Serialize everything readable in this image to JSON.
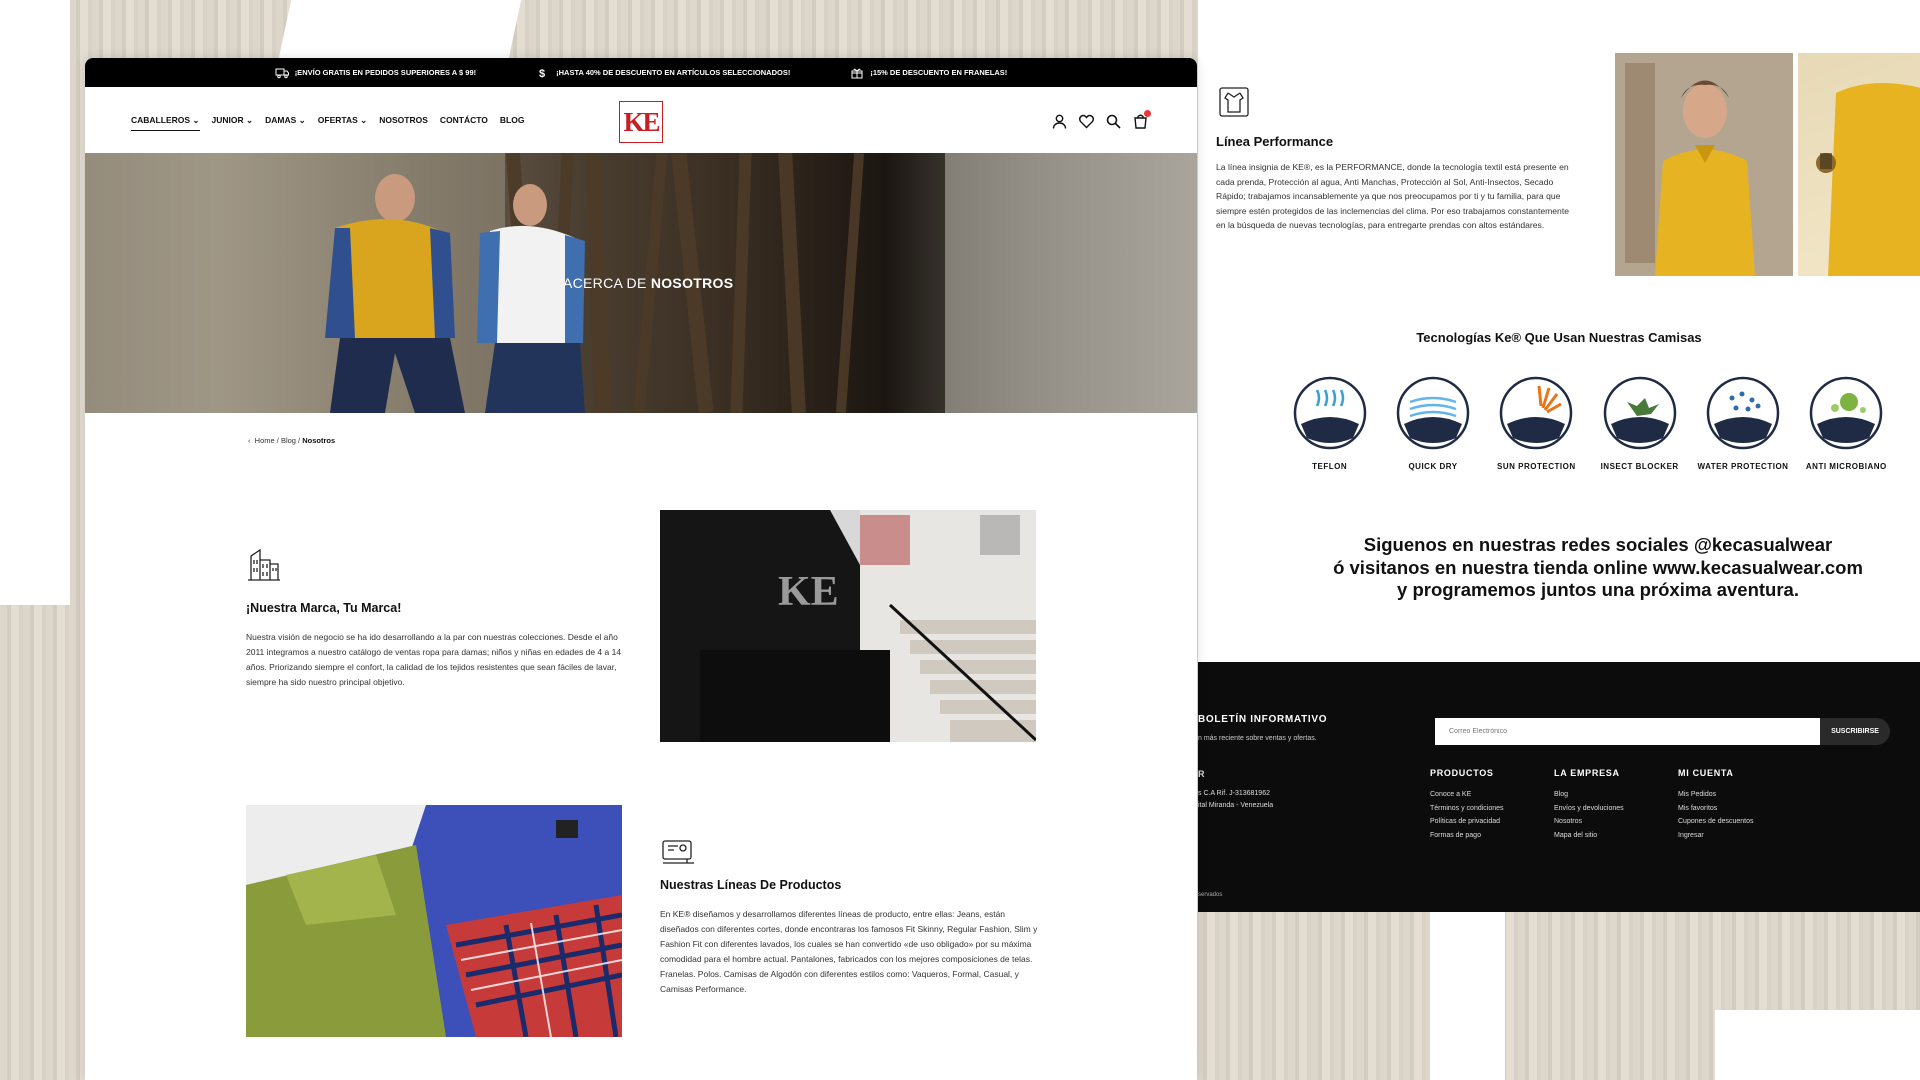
{
  "topbar": {
    "item1": "¡ENVÍO GRATIS EN PEDIDOS SUPERIORES A $ 99!",
    "item2": "¡HASTA 40% DE DESCUENTO EN ARTÍCULOS SELECCIONADOS!",
    "item3": "¡15% DE DESCUENTO EN FRANELAS!"
  },
  "nav": {
    "menu": [
      "CABALLEROS",
      "JUNIOR",
      "DAMAS",
      "OFERTAS",
      "NOSOTROS",
      "CONTÁCTO",
      "BLOG"
    ],
    "logo": "KE"
  },
  "hero": {
    "title_light": "ACERCA DE",
    "title_bold": "NOSOTROS"
  },
  "breadcrumb": {
    "home": "Home",
    "blog": "Blog",
    "current": "Nosotros"
  },
  "brand": {
    "title": "¡Nuestra Marca, Tu Marca!",
    "text": "Nuestra visión de negocio se ha ido desarrollando a la par con nuestras colecciones. Desde el año 2011 integramos a nuestro catálogo de ventas ropa para damas; niños y niñas en edades de 4 a 14 años. Priorizando siempre el confort, la calidad de los tejidos resistentes que sean fáciles de lavar, siempre ha sido nuestro principal objetivo."
  },
  "lines": {
    "title": "Nuestras Líneas De Productos",
    "text": "En KE® diseñamos y desarrollamos diferentes líneas de producto, entre ellas: Jeans, están diseñados con diferentes cortes, donde encontraras los famosos Fit Skinny, Regular Fashion, Slim y Fashion Fit con diferentes lavados, los cuales se han convertido «de uso obligado» por su máxima comodidad para el hombre actual. Pantalones, fabricados con los mejores composiciones de telas. Franelas. Polos. Camisas de Algodón con diferentes estilos como: Vaqueros, Formal, Casual, y Camisas Performance."
  },
  "performance": {
    "title": "Línea Performance",
    "text": "La línea insignia de KE®, es la PERFORMANCE, donde la tecnología textil está presente en cada prenda, Protección al agua, Anti Manchas, Protección al Sol, Anti-Insectos, Secado Rápido; trabajamos incansablemente ya que nos preocupamos por ti y tu familia, para que siempre estén protegidos de las inclemencias del clima. Por eso trabajamos constantemente en la búsqueda de nuevas tecnologías, para entregarte prendas con altos estándares."
  },
  "tech": {
    "title": "Tecnologías Ke® Que Usan Nuestras Camisas",
    "items": [
      {
        "label": "TEFLON",
        "icon": "teflon-icon",
        "color": "#2b6cb0"
      },
      {
        "label": "QUICK DRY",
        "icon": "quick-dry-icon",
        "color": "#3182ce"
      },
      {
        "label": "SUN PROTECTION",
        "icon": "sun-protection-icon",
        "color": "#dd6b20"
      },
      {
        "label": "INSECT BLOCKER",
        "icon": "insect-blocker-icon",
        "color": "#4a7a3a"
      },
      {
        "label": "WATER PROTECTION",
        "icon": "water-protection-icon",
        "color": "#2b6cb0"
      },
      {
        "label": "ANTI MICROBIANO",
        "icon": "anti-microbiano-icon",
        "color": "#6aa84f"
      }
    ]
  },
  "social": {
    "line1": "Siguenos en nuestras redes sociales @kecasualwear",
    "line2": "ó visitanos en nuestra tienda online www.kecasualwear.com",
    "line3": "y programemos juntos una próxima aventura."
  },
  "footer": {
    "newsletter_title": "BOLETÍN INFORMATIVO",
    "newsletter_sub": "n más reciente sobre ventas y ofertas.",
    "email_placeholder": "Correo Electrónico",
    "subscribe": "SUSCRIBIRSE",
    "company_head": "R",
    "company_line1": "s C.A Rif. J-313681962",
    "company_line2": "ital Miranda - Venezuela",
    "products": {
      "title": "PRODUCTOS",
      "links": [
        "Conoce a KE",
        "Términos y condiciones",
        "Políticas de privacidad",
        "Formas de pago"
      ]
    },
    "company": {
      "title": "LA EMPRESA",
      "links": [
        "Blog",
        "Envíos y devoluciones",
        "Nosotros",
        "Mapa del sitio"
      ]
    },
    "account": {
      "title": "MI CUENTA",
      "links": [
        "Mis Pedidos",
        "Mis favoritos",
        "Cupones de descuentos",
        "Ingresar"
      ]
    },
    "rights": "servados"
  },
  "colors": {
    "brand_red": "#c91d24",
    "footer_bg": "#0c0c0c",
    "topbar_bg": "#000000"
  }
}
